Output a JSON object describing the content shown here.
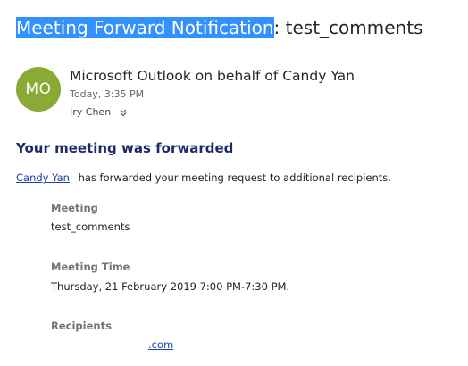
{
  "subject": {
    "highlighted": "Meeting Forward Notification",
    "rest": ": test_comments"
  },
  "sender": {
    "avatar_initials": "MO",
    "avatar_color": "#8aa935",
    "name": "Microsoft Outlook on behalf of Candy Yan",
    "date": "Today, 3:35 PM",
    "to": "Iry Chen",
    "expand_icon": "chevron-down-icon"
  },
  "body": {
    "heading": "Your meeting was forwarded",
    "forwarder_link": "Candy Yan",
    "forward_text": "has forwarded your meeting request to additional recipients.",
    "meeting_label": "Meeting",
    "meeting_value": "test_comments",
    "time_label": "Meeting Time",
    "time_value": "Thursday, 21 February 2019 7:00 PM-7:30 PM.",
    "recipients_label": "Recipients",
    "recipient_suffix": ".com"
  },
  "colors": {
    "highlight": "#3390ff",
    "heading": "#1f2a6b",
    "link": "#1f3fa8"
  }
}
